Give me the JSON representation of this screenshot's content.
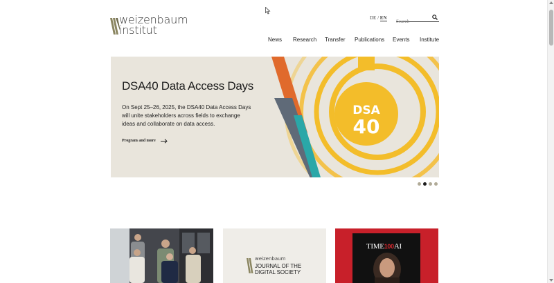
{
  "brand": {
    "line1": "weizenbaum",
    "line2": "institut"
  },
  "language": {
    "de": "DE",
    "separator": " / ",
    "en": "EN"
  },
  "search": {
    "placeholder": "Search"
  },
  "nav": {
    "items": [
      "News",
      "Research",
      "Transfer",
      "Publications",
      "Events",
      "Institute"
    ]
  },
  "hero": {
    "title": "DSA40 Data Access Days",
    "description": "On Sept 25–26, 2025, the DSA40 Data Access Days will unite stakeholders across fields to exchange ideas and collaborate on data access.",
    "link_label": "Program and more",
    "badge_line1": "DSA",
    "badge_line2": "40"
  },
  "carousel": {
    "slide_count": 4,
    "active_index": 1
  },
  "cards": {
    "journal": {
      "small": "weizenbaum",
      "line1": "JOURNAL OF THE",
      "line2": "DIGITAL SOCIETY"
    },
    "time": {
      "prefix": "TIME",
      "number": "100",
      "suffix": "AI"
    }
  },
  "colors": {
    "hero_bg": "#e9e5dc",
    "accent_yellow": "#f3bd2a",
    "accent_orange": "#e06a2c",
    "accent_slate": "#5f6a78",
    "accent_teal": "#2aa7a8",
    "logo_olive": "#8a8560",
    "time_red": "#c8202a"
  }
}
